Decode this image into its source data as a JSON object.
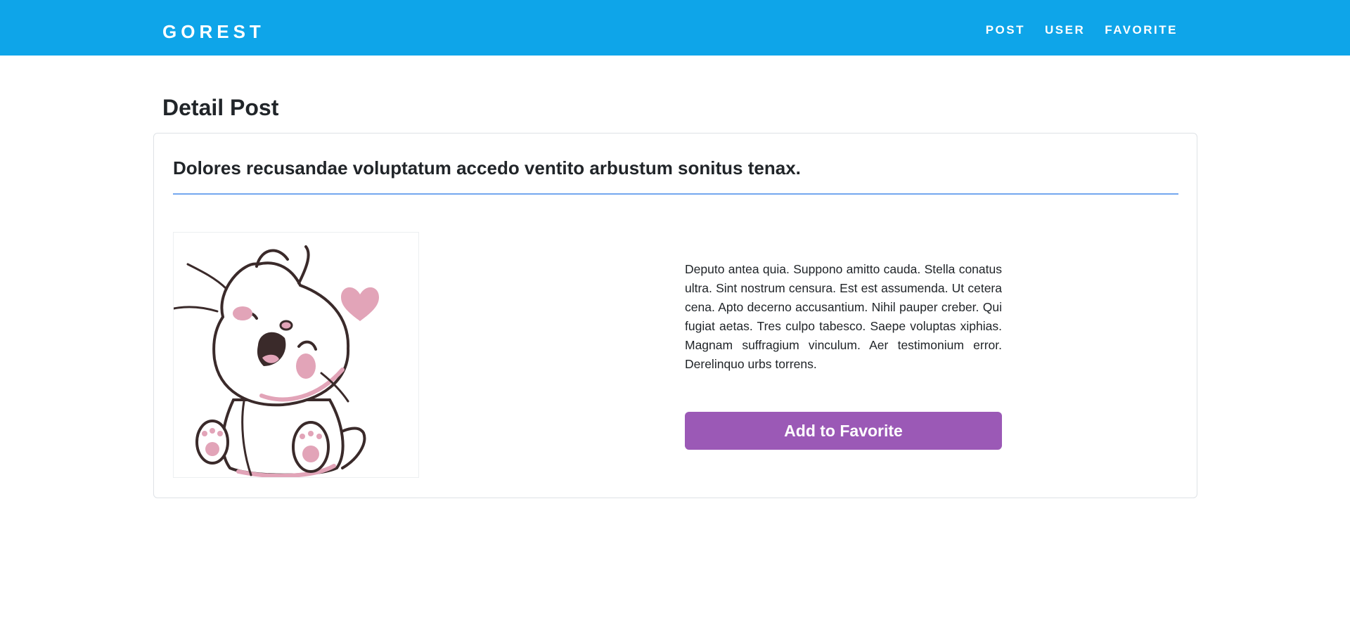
{
  "navbar": {
    "brand": "GOREST",
    "links": [
      {
        "label": "POST"
      },
      {
        "label": "USER"
      },
      {
        "label": "FAVORITE"
      }
    ],
    "background": "#0ea5e9"
  },
  "page": {
    "title": "Detail Post"
  },
  "post": {
    "title": "Dolores recusandae voluptatum accedo ventito arbustum sonitus tenax.",
    "body": "Deputo antea quia. Suppono amitto cauda. Stella conatus ultra. Sint nostrum censura. Est est assumenda. Ut cetera cena. Apto decerno accusantium. Nihil pauper creber. Qui fugiat aetas. Tres culpo tabesco. Saepe voluptas xiphias. Magnam suffragium vinculum. Aer testimonium error. Derelinquo urbs torrens.",
    "image_icon": "cat-illustration-icon",
    "favorite_button_label": "Add to Favorite",
    "favorite_button_color": "#9b59b6",
    "divider_color": "#74a7ef"
  }
}
